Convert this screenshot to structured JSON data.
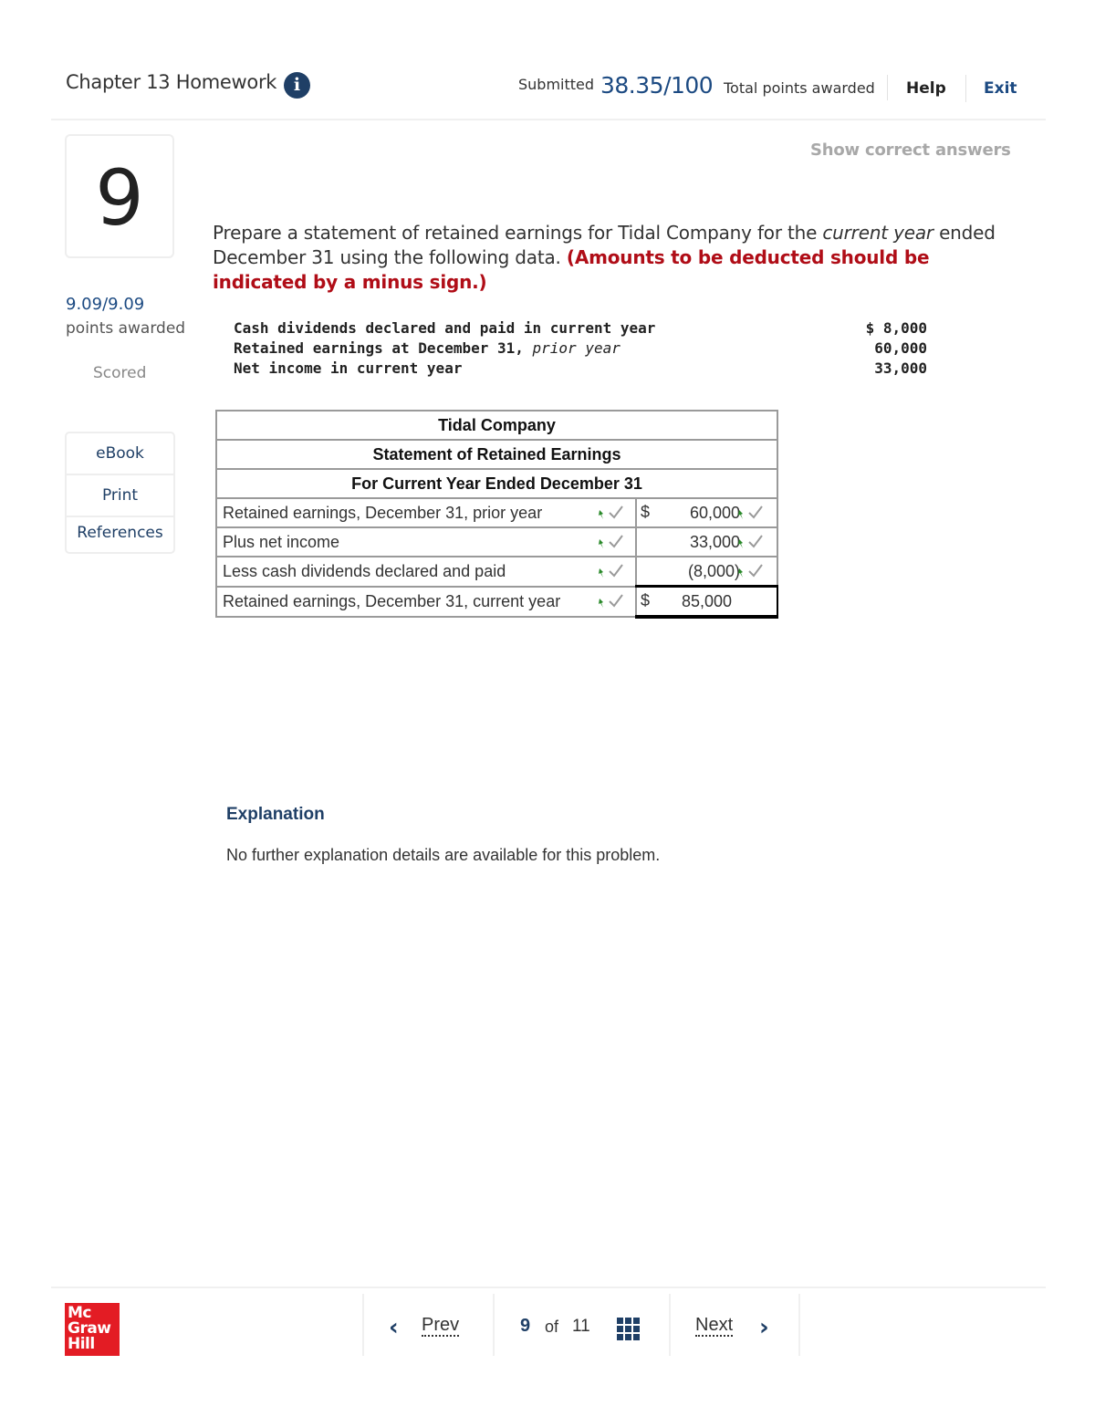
{
  "header": {
    "title": "Chapter 13 Homework",
    "info_icon": "info-circle-icon",
    "submitted_label": "Submitted",
    "score": "38.35/100",
    "total_label": "Total points awarded",
    "help_label": "Help",
    "exit_label": "Exit"
  },
  "question": {
    "number": "9",
    "points": "9.09/9.09",
    "points_label": "points awarded",
    "status": "Scored",
    "show_answers_label": "Show correct answers",
    "prompt_part1": "Prepare a statement of retained earnings for Tidal Company for the ",
    "prompt_italic": "current year",
    "prompt_part2": " ended December 31 using the following data. ",
    "prompt_note": "(Amounts to be deducted should be indicated by a minus sign.)",
    "givens": [
      {
        "label": "Cash dividends declared and paid in current year",
        "label_italic": "",
        "value": "$ 8,000"
      },
      {
        "label": "Retained earnings at December 31, ",
        "label_italic": "prior year",
        "value": "60,000"
      },
      {
        "label": "Net income in current year",
        "label_italic": "",
        "value": "33,000"
      }
    ]
  },
  "tools": {
    "ebook": "eBook",
    "print": "Print",
    "references": "References"
  },
  "statement": {
    "company": "Tidal Company",
    "title": "Statement of Retained Earnings",
    "period": "For Current Year Ended December 31",
    "rows": [
      {
        "label": "Retained earnings, December 31, prior year",
        "currency": "$",
        "amount": "60,000",
        "label_correct": true,
        "amount_correct": true
      },
      {
        "label": "Plus net income",
        "currency": "",
        "amount": "33,000",
        "label_correct": true,
        "amount_correct": true
      },
      {
        "label": "Less cash dividends declared and paid",
        "currency": "",
        "amount": "(8,000)",
        "label_correct": true,
        "amount_correct": true
      },
      {
        "label": "Retained earnings, December 31, current year",
        "currency": "$",
        "amount": "85,000",
        "label_correct": true,
        "amount_correct": false
      }
    ],
    "colors": {
      "check": "#9a9a9a",
      "pin": "#2a8a2a"
    }
  },
  "explanation": {
    "heading": "Explanation",
    "text": "No further explanation details are available for this problem."
  },
  "footer": {
    "logo_lines": [
      "Mc",
      "Graw",
      "Hill"
    ],
    "prev_label": "Prev",
    "current_page": "9",
    "of_label": "of",
    "total_pages": "11",
    "next_label": "Next",
    "grid_icon": "question-grid-icon"
  },
  "colors": {
    "brand_blue": "#1c4a82",
    "navy": "#1f3f66",
    "alert_red": "#b00d17",
    "logo_red": "#e31c24"
  }
}
